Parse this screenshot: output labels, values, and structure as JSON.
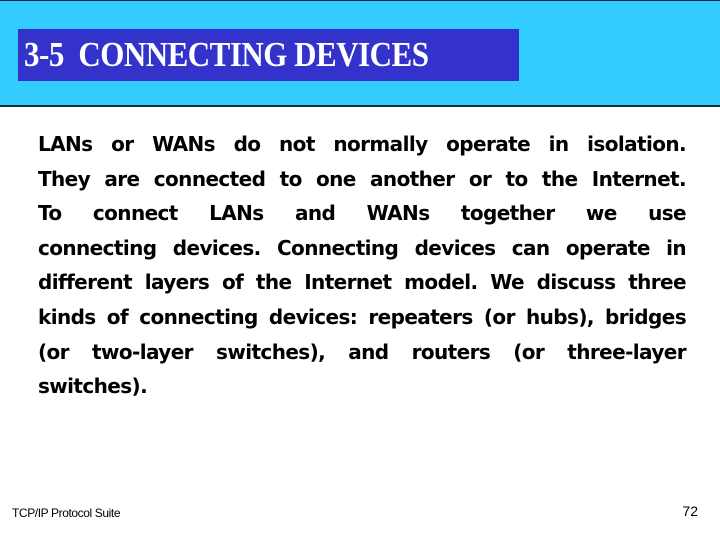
{
  "slide": {
    "title": "3-5  CONNECTING DEVICES",
    "colors": {
      "header_band": "#33ccff",
      "title_box": "#3333cc",
      "title_text": "#ffffff",
      "body_text": "#000000"
    },
    "body_lines": [
      "LANs or WANs do not normally operate in isolation.",
      "They are connected to one another or to the Internet.",
      "To connect LANs and WANs together we use",
      "connecting devices. Connecting devices can operate in",
      "different layers of the Internet model. We discuss three",
      "kinds of connecting devices: repeaters (or hubs), bridges",
      "(or two-layer switches), and routers (or three-layer",
      "switches)."
    ],
    "footer": {
      "left": "TCP/IP Protocol Suite",
      "page_number": "72"
    }
  }
}
